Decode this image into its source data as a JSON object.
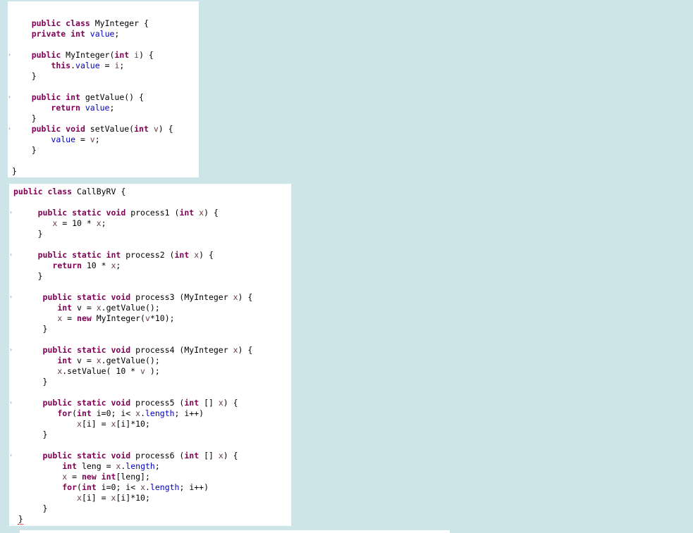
{
  "myinteger_code": {
    "l1": "public class MyInteger {",
    "l2": "    private int value;",
    "l3": "    public MyInteger(int i) {",
    "l4": "        this.value = i;",
    "l5": "    }",
    "l6": "    public int getValue() {",
    "l7": "        return value;",
    "l8": "    }",
    "l9": "    public void setValue(int v) {",
    "l10": "        value = v;",
    "l11": "    }",
    "l12": "}"
  },
  "callbyrv_code": {
    "l1": "public class CallByRV {",
    "l2": "     public static void process1 (int x) {",
    "l3": "        x = 10 * x;",
    "l4": "     }",
    "l5": "     public static int process2 (int x) {",
    "l6": "        return 10 * x;",
    "l7": "     }",
    "l8": "      public static void process3 (MyInteger x) {",
    "l9": "         int v = x.getValue();",
    "l10": "         x = new MyInteger(v*10);",
    "l11": "      }",
    "l12": "      public static void process4 (MyInteger x) {",
    "l13": "         int v = x.getValue();",
    "l14": "         x.setValue( 10 * v );",
    "l15": "      }",
    "l16": "      public static void process5 (int [] x) {",
    "l17": "         for(int i=0; i< x.length; i++)",
    "l18": "             x[i] = x[i]*10;",
    "l19": "      }",
    "l20": "      public static void process6 (int [] x) {",
    "l21": "          int leng = x.length;",
    "l22": "          x = new int[leng];",
    "l23": "          for(int i=0; i< x.length; i++)",
    "l24": "             x[i] = x[i]*10;",
    "l25": "      }",
    "l26": " }"
  },
  "colors": {
    "background": "#cde4e8",
    "keyword": "#7f0055",
    "field": "#0000c0",
    "parameter": "#6a3e3e"
  }
}
